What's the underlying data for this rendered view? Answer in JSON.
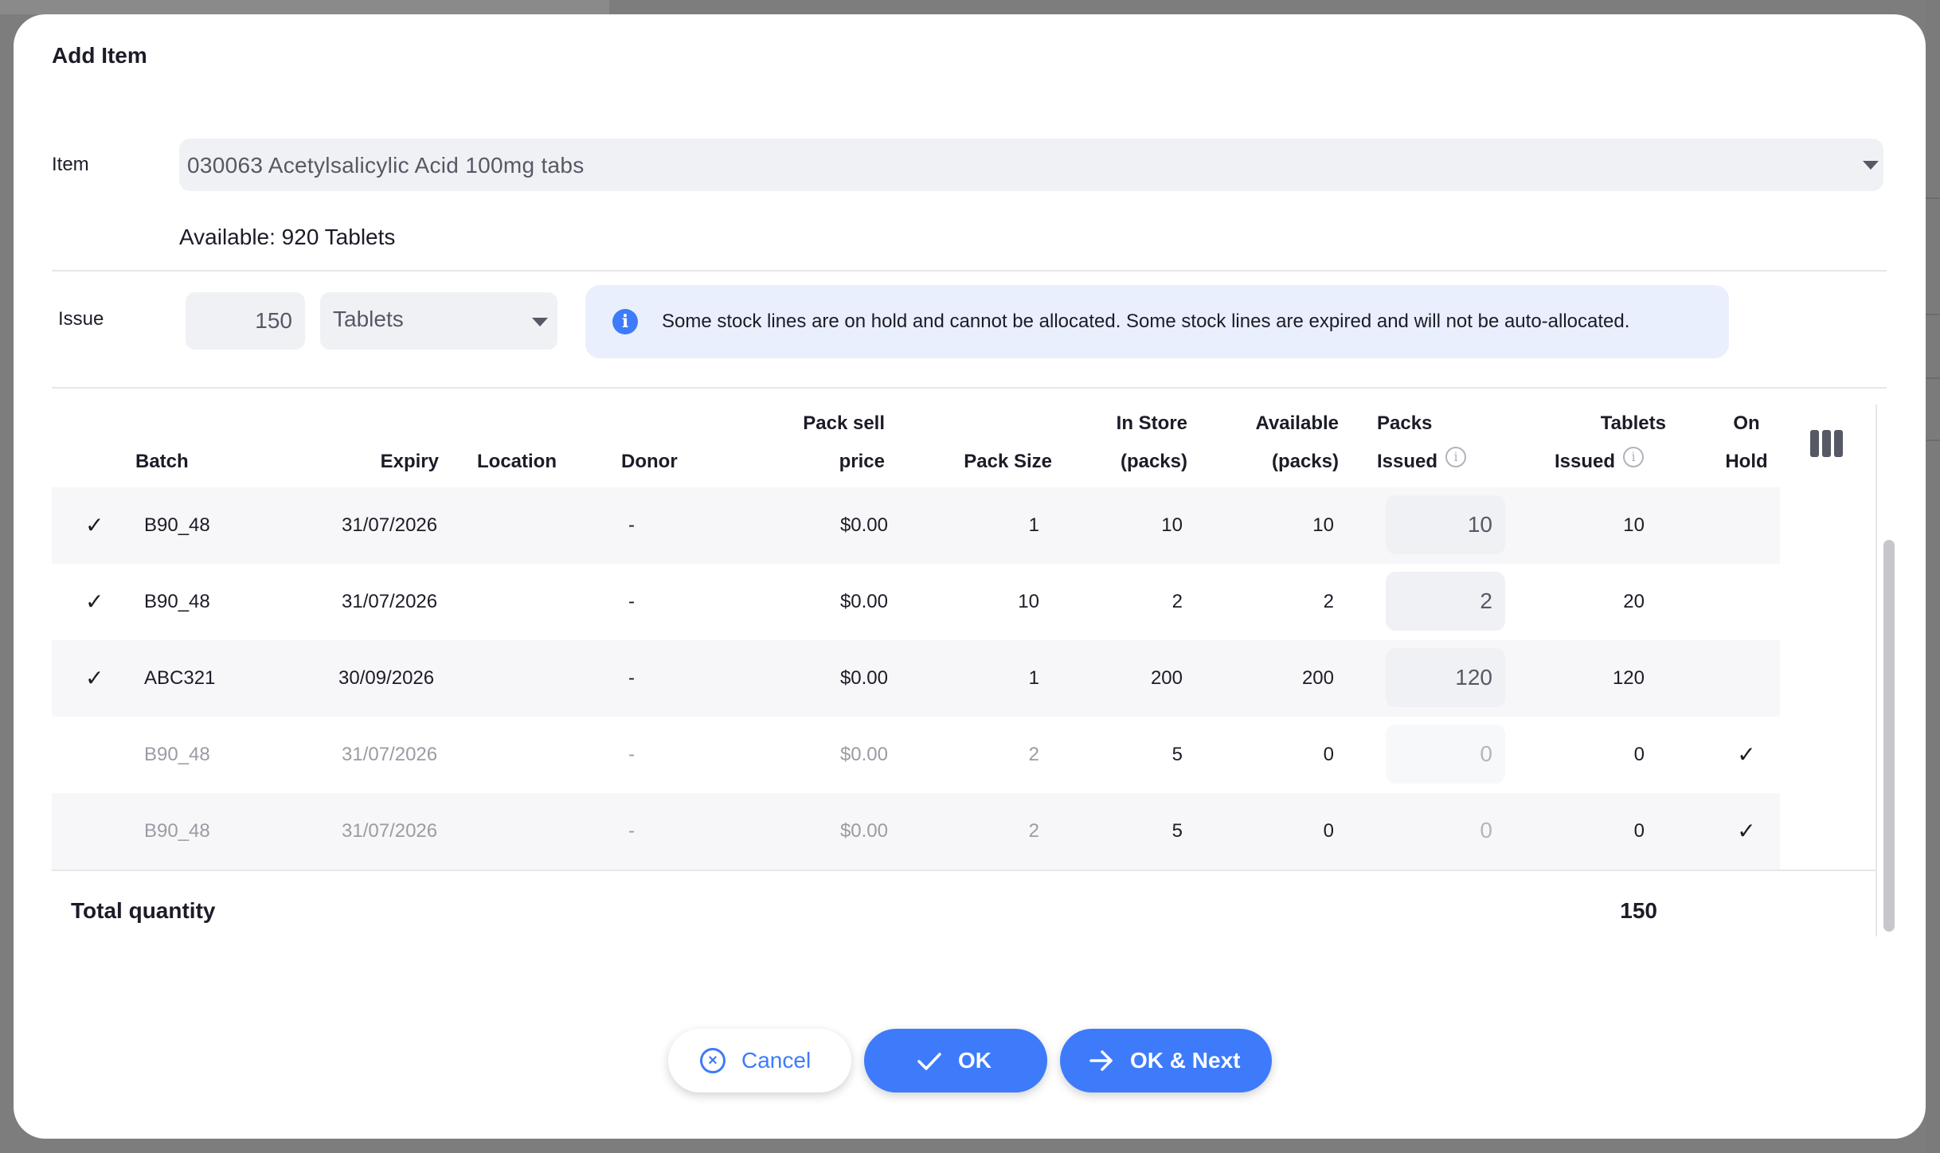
{
  "dialog": {
    "title": "Add Item",
    "item_label": "Item",
    "item_value": "030063 Acetylsalicylic Acid 100mg tabs",
    "available_text": "Available: 920 Tablets",
    "issue_label": "Issue",
    "issue_qty": "150",
    "issue_unit": "Tablets",
    "alert_text": "Some stock lines are on hold and cannot be allocated. Some stock lines are expired and will not be auto-allocated."
  },
  "table": {
    "headers": {
      "batch": "Batch",
      "expiry": "Expiry",
      "location": "Location",
      "donor": "Donor",
      "pack_sell_1": "Pack sell",
      "pack_sell_2": "price",
      "pack_size": "Pack Size",
      "in_store_1": "In Store",
      "in_store_2": "(packs)",
      "available_1": "Available",
      "available_2": "(packs)",
      "packs_issued_1": "Packs",
      "packs_issued_2": "Issued",
      "tablets_issued_1": "Tablets",
      "tablets_issued_2": "Issued",
      "on_hold_1": "On",
      "on_hold_2": "Hold"
    },
    "rows": [
      {
        "check": "✓",
        "batch": "B90_48",
        "expiry": "31/07/2026",
        "donor": "-",
        "price": "$0.00",
        "pack_size": "1",
        "in_store": "10",
        "available": "10",
        "packs_issued": "10",
        "tablets_issued": "10",
        "on_hold": ""
      },
      {
        "check": "✓",
        "batch": "B90_48",
        "expiry": "31/07/2026",
        "donor": "-",
        "price": "$0.00",
        "pack_size": "10",
        "in_store": "2",
        "available": "2",
        "packs_issued": "2",
        "tablets_issued": "20",
        "on_hold": ""
      },
      {
        "check": "✓",
        "batch": "ABC321",
        "expiry": "30/09/2026",
        "donor": "-",
        "price": "$0.00",
        "pack_size": "1",
        "in_store": "200",
        "available": "200",
        "packs_issued": "120",
        "tablets_issued": "120",
        "on_hold": ""
      },
      {
        "check": "",
        "batch": "B90_48",
        "expiry": "31/07/2026",
        "donor": "-",
        "price": "$0.00",
        "pack_size": "2",
        "in_store": "5",
        "available": "0",
        "packs_issued": "0",
        "tablets_issued": "0",
        "on_hold": "✓"
      },
      {
        "check": "",
        "batch": "B90_48",
        "expiry": "31/07/2026",
        "donor": "-",
        "price": "$0.00",
        "pack_size": "2",
        "in_store": "5",
        "available": "0",
        "packs_issued": "0",
        "tablets_issued": "0",
        "on_hold": "✓"
      }
    ],
    "total_label": "Total quantity",
    "total_value": "150"
  },
  "buttons": {
    "cancel": "Cancel",
    "ok": "OK",
    "ok_next": "OK & Next"
  },
  "colors": {
    "accent": "#3e7bfa",
    "alert_bg": "#e9effd"
  }
}
